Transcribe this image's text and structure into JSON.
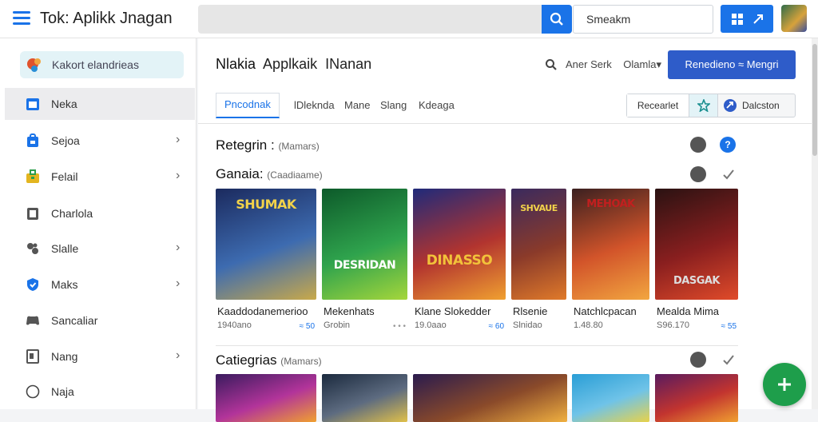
{
  "app": {
    "title": "Tok: Aplikk Jnagan",
    "search_input_value": "Smeakm"
  },
  "sidebar": {
    "first_item": "Kakort elandrieas",
    "items": [
      {
        "label": "Neka",
        "chevron": ""
      },
      {
        "label": "Sejoa",
        "chevron": "›"
      },
      {
        "label": "Felail",
        "chevron": "›"
      },
      {
        "label": "Charlola",
        "chevron": ""
      },
      {
        "label": "Slalle",
        "chevron": "›"
      },
      {
        "label": "Maks",
        "chevron": "›"
      },
      {
        "label": "Sancaliar",
        "chevron": ""
      },
      {
        "label": "Nang",
        "chevron": "›"
      },
      {
        "label": "Naja",
        "chevron": ""
      }
    ]
  },
  "header": {
    "title_part1": "Nlakia",
    "title_part2": "Applkaik",
    "title_part3": "INanan",
    "link1": "Aner Serk",
    "link2": "Olamla▾",
    "primary_button": "Renedieno ≈ Mengri"
  },
  "tabs": [
    {
      "label": "Pncodnak",
      "active": true
    },
    {
      "label": "lDleknda"
    },
    {
      "label": "Mane"
    },
    {
      "label": "Slang"
    },
    {
      "label": "Kdeaga"
    }
  ],
  "segment": {
    "left_label": "Recearlet",
    "right_label": "Dalcston"
  },
  "sections": {
    "section1_title": "Retegrin :",
    "section1_sub": "(Mamars)",
    "section2_title": "Ganaia:",
    "section2_sub": "(Caadiaame)",
    "section3_title": "Catiegrias",
    "section3_sub": "(Mamars)"
  },
  "games": [
    {
      "name": "Kaaddodanemerioo",
      "meta": "1940ano",
      "tag": "≈ 50",
      "art": "SHUMAK",
      "colors": [
        "#1b2a5e",
        "#3d6bb0",
        "#c9a94a"
      ]
    },
    {
      "name": "Mekenhats",
      "meta": "Grobin",
      "tag": "• • •",
      "art": "DESRIDAN",
      "colors": [
        "#0d5a2a",
        "#2fa34d",
        "#a5d63b"
      ]
    },
    {
      "name": "Klane Slokedder",
      "meta": "19.0aao",
      "tag": "≈ 60",
      "art": "DINASSO",
      "colors": [
        "#1f2a7a",
        "#b2342f",
        "#f0a030"
      ]
    },
    {
      "name": "Rlsenie",
      "meta": "Slnidao",
      "tag": "",
      "art": "SHVAUE",
      "colors": [
        "#3a2a5e",
        "#8a3a2a",
        "#e07a2a"
      ]
    },
    {
      "name": "Natchlcpacan",
      "meta": "1.48.80",
      "tag": "",
      "art": "MEHOAK",
      "colors": [
        "#3b2020",
        "#d2542a",
        "#f2a640"
      ]
    },
    {
      "name": "Mealda Mima",
      "meta": "S96.170",
      "tag": "≈ 55",
      "art": "DASGAK",
      "colors": [
        "#2a1212",
        "#8a1f1f",
        "#e04b2a"
      ]
    }
  ],
  "colors": {
    "accent": "#1a73e8",
    "primary_button": "#2e5cc9",
    "fab": "#1e9e4b"
  }
}
